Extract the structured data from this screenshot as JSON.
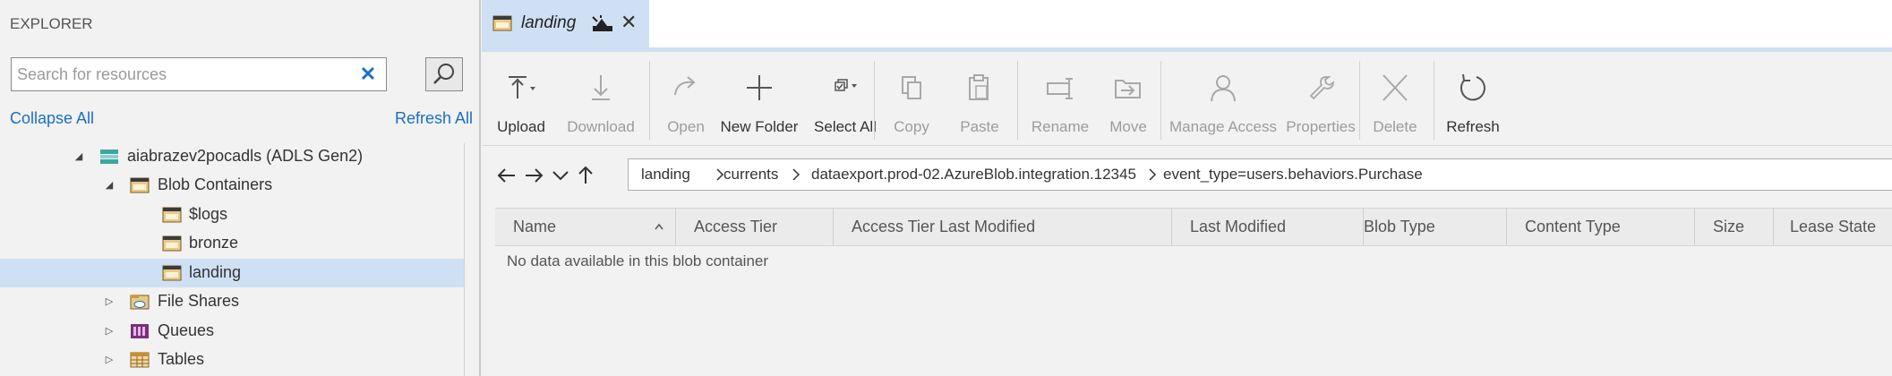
{
  "explorer": {
    "title": "EXPLORER",
    "search_placeholder": "Search for resources",
    "collapse_all": "Collapse All",
    "refresh_all": "Refresh All",
    "tree": [
      {
        "label": "aiabrazev2pocadls (ADLS Gen2)",
        "icon": "storage-account-icon",
        "expanded": true
      },
      {
        "label": "Blob Containers",
        "icon": "blob-containers-icon",
        "expanded": true
      },
      {
        "label": "$logs",
        "icon": "container-icon"
      },
      {
        "label": "bronze",
        "icon": "container-icon"
      },
      {
        "label": "landing",
        "icon": "container-icon",
        "selected": true
      },
      {
        "label": "File Shares",
        "icon": "file-shares-icon",
        "expanded": false
      },
      {
        "label": "Queues",
        "icon": "queues-icon",
        "expanded": false
      },
      {
        "label": "Tables",
        "icon": "tables-icon",
        "expanded": false
      }
    ]
  },
  "tab": {
    "title": "landing",
    "close": "✕"
  },
  "toolbar": {
    "upload": "Upload",
    "download": "Download",
    "open": "Open",
    "new_folder": "New Folder",
    "select_all": "Select All",
    "copy": "Copy",
    "paste": "Paste",
    "rename": "Rename",
    "move": "Move",
    "manage_access": "Manage Access",
    "properties": "Properties",
    "delete": "Delete",
    "refresh": "Refresh"
  },
  "breadcrumb": [
    "landing",
    "currents",
    "dataexport.prod-02.AzureBlob.integration.12345",
    "event_type=users.behaviors.Purchase"
  ],
  "grid": {
    "columns": [
      "Name",
      "Access Tier",
      "Access Tier Last Modified",
      "Last Modified",
      "Blob Type",
      "Content Type",
      "Size",
      "Lease State"
    ],
    "empty_message": "No data available in this blob container"
  },
  "colors": {
    "accent": "#1a6fc4",
    "selected": "#cfe0f4",
    "disabled_text": "#9c9c9c"
  }
}
